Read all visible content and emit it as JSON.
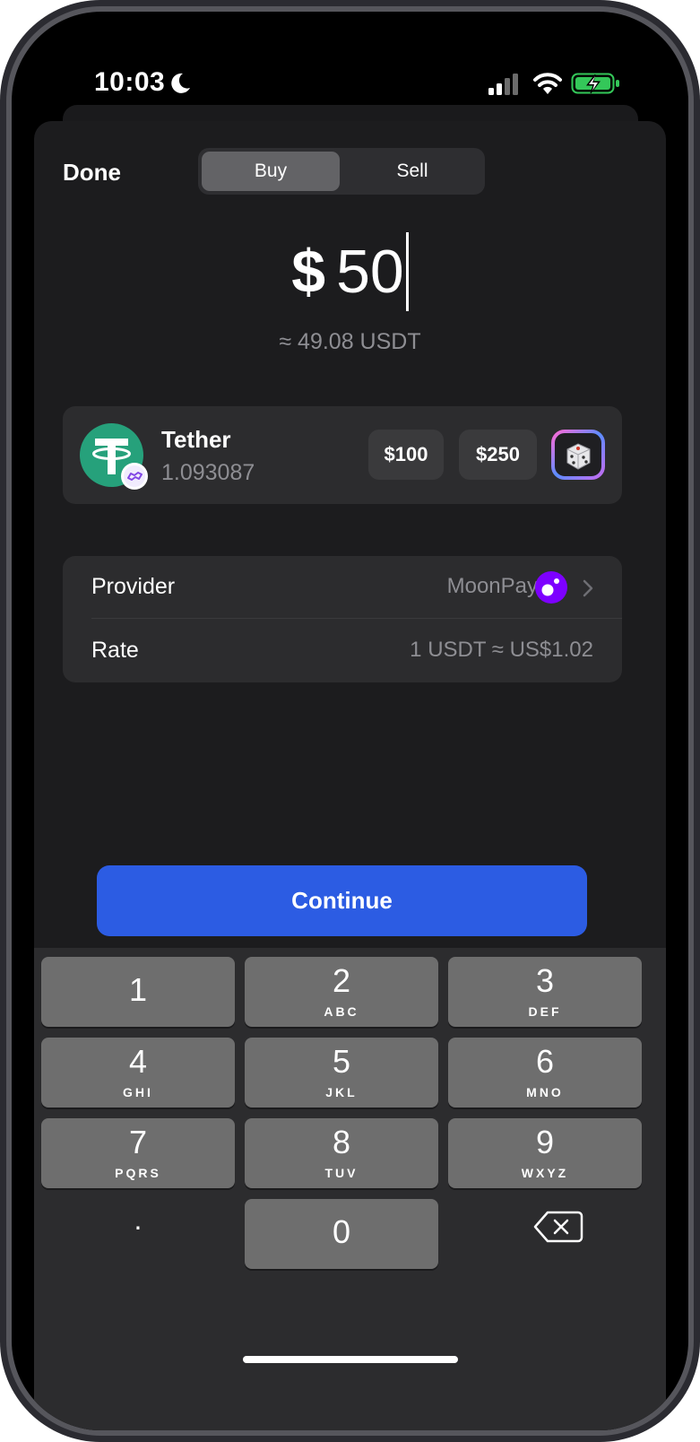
{
  "status_bar": {
    "time": "10:03"
  },
  "header": {
    "done_label": "Done",
    "tabs": [
      {
        "label": "Buy",
        "selected": true
      },
      {
        "label": "Sell",
        "selected": false
      }
    ]
  },
  "amount": {
    "currency_symbol": "$",
    "value": "50",
    "approx": "≈ 49.08 USDT"
  },
  "token": {
    "name": "Tether",
    "balance": "1.093087",
    "presets": [
      "$100",
      "$250"
    ]
  },
  "details": {
    "provider_label": "Provider",
    "provider_value": "MoonPay",
    "rate_label": "Rate",
    "rate_value": "1 USDT ≈ US$1.02"
  },
  "continue_label": "Continue",
  "keypad": {
    "keys": [
      {
        "num": "1",
        "letters": ""
      },
      {
        "num": "2",
        "letters": "ABC"
      },
      {
        "num": "3",
        "letters": "DEF"
      },
      {
        "num": "4",
        "letters": "GHI"
      },
      {
        "num": "5",
        "letters": "JKL"
      },
      {
        "num": "6",
        "letters": "MNO"
      },
      {
        "num": "7",
        "letters": "PQRS"
      },
      {
        "num": "8",
        "letters": "TUV"
      },
      {
        "num": "9",
        "letters": "WXYZ"
      },
      {
        "num": "0",
        "letters": ""
      }
    ],
    "decimal": "."
  },
  "colors": {
    "accent": "#2c5ce3",
    "tether": "#26a17b",
    "moonpay": "#7d00ff",
    "battery": "#34c759"
  }
}
